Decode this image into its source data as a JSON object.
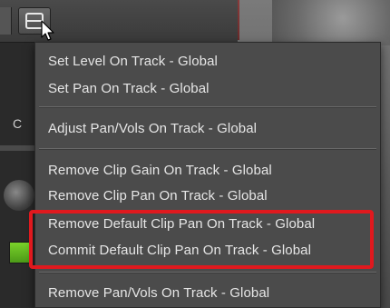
{
  "menu": {
    "items": [
      {
        "label": "Set Level On Track - Global"
      },
      {
        "label": "Set Pan On Track - Global"
      },
      {
        "label": "Adjust Pan/Vols On Track - Global"
      },
      {
        "label": "Remove Clip Gain On Track - Global"
      },
      {
        "label": "Remove Clip Pan On Track - Global"
      },
      {
        "label": "Remove Default Clip Pan On Track - Global"
      },
      {
        "label": "Commit Default Clip Pan On Track - Global"
      },
      {
        "label": "Remove Pan/Vols On Track - Global"
      }
    ]
  },
  "background": {
    "track_header_letter": "C"
  },
  "colors": {
    "menu_background": "#4b4b4b",
    "menu_text": "#e6e6e6",
    "highlight_outline": "#e0191e"
  },
  "icons": {
    "menu_button": "list-menu-icon",
    "cursor": "pointer-cursor-icon"
  }
}
